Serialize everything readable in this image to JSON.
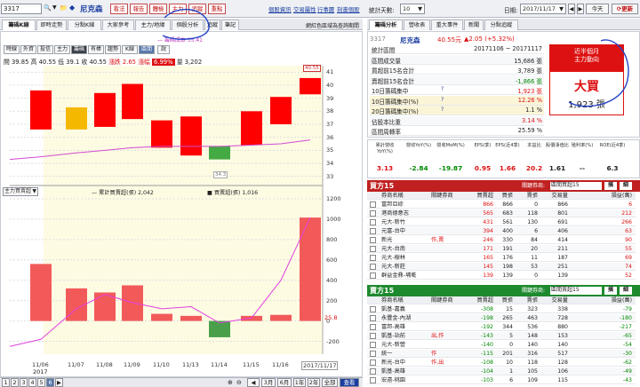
{
  "topbar": {
    "code": "3317",
    "stock_name": "尼克森",
    "buttons": [
      "看法",
      "報告",
      "體檢",
      "主力",
      "追蹤",
      "重點"
    ],
    "links": [
      "個股資訊",
      "交易屬性",
      "行事曆",
      "刻畫個股"
    ],
    "days_label": "統計天數:",
    "days_value": "10",
    "date_label": "日期:",
    "date_value": "2017/11/17",
    "today_btn": "今天",
    "refresh_btn": "更新"
  },
  "left_tabs": [
    "籌碼K線",
    "即時走勢",
    "分點K線",
    "大家參考",
    "主力/地緣",
    "個股分析",
    "追蹤",
    "筆記"
  ],
  "left_tab_note": "網紅色區域為查詢期間",
  "sub_buttons": [
    "時線",
    "外資",
    "投信",
    "主力",
    "籌碼",
    "有棒",
    "趨勢",
    "K線",
    "區間",
    "說"
  ],
  "quote": {
    "open_label": "開",
    "open": "39.85",
    "high_label": "高",
    "high": "40.55",
    "low_label": "低",
    "low": "39.1",
    "close_label": "收",
    "close": "40.55",
    "change_label": "漲跌",
    "change": "2.65",
    "pct_label": "漲幅",
    "pct": "6.99%",
    "vol_label": "量",
    "vol": "3,202"
  },
  "ma_note": "— 籌碼成本 35.41",
  "price_axis": [
    "41",
    "40",
    "39",
    "38",
    "37",
    "36",
    "35",
    "34",
    "33"
  ],
  "price_marks": {
    "high": "40.55",
    "low": "34.3"
  },
  "lower_legend": {
    "select": "主力買賣超",
    "line": "— 累計買賣超(張) 2,042",
    "bar": "■ 買賣超(張) 1,016"
  },
  "vol_axis": [
    "1200",
    "1000",
    "800",
    "600",
    "400",
    "200",
    "0",
    "-200"
  ],
  "vol_mark": "25.8",
  "x_labels": [
    "11/06",
    "11/07",
    "11/08",
    "11/09",
    "11/10",
    "11/13",
    "11/14",
    "11/15",
    "11/16",
    "2017/11/17"
  ],
  "x_year": "2017",
  "bottom": {
    "pages": [
      "1",
      "2",
      "3",
      "4",
      "5",
      "6"
    ],
    "zoom": [
      "3月",
      "6月",
      "1年",
      "2年",
      "全部",
      "查看"
    ]
  },
  "right_tabs": [
    "籌碼分析",
    "營收表",
    "重大事件",
    "新聞",
    "分點追蹤"
  ],
  "summary": {
    "code": "3317",
    "name": "尼克森",
    "price": "40.55元",
    "change": "▲2.05 (+5.32%)",
    "rows": [
      {
        "label": "統計區間",
        "value": "20171106 ~ 20171117"
      },
      {
        "label": "區間成交量",
        "value": "15,686 張"
      },
      {
        "label": "買超前15名合計",
        "value": "3,789 張"
      },
      {
        "label": "賣超前15名合計",
        "value": "-1,866 張"
      },
      {
        "label": "10日籌碼集中",
        "value": "1,923 張"
      },
      {
        "label": "10日籌碼集中(%)",
        "value": "12.26 %"
      },
      {
        "label": "20日籌碼集中(%)",
        "value": "1.1 %"
      },
      {
        "label": "佔股本比重",
        "value": "3.14 %"
      },
      {
        "label": "區間周轉率",
        "value": "25.59 %"
      }
    ],
    "badge_title": "近半個月",
    "badge_sub": "主力動向",
    "badge_main": "大買",
    "badge_value": "1,923 張"
  },
  "stats_head": [
    "累計營收YoY(%)",
    "營收YoY(%)",
    "營收MoM(%)",
    "EPS(季)",
    "EPS(近4季)",
    "本益比",
    "股價淨值比",
    "殖利率(%)",
    "ROE(近4季)"
  ],
  "stats_vals": [
    "3.13",
    "-2.84",
    "-19.87",
    "0.95",
    "1.66",
    "20.2",
    "1.61",
    "--",
    "6.3"
  ],
  "buy15": {
    "title": "買方15",
    "select_label": "關鍵券商:",
    "select_value": "區間買超15",
    "head": [
      "券商名稱",
      "關鍵券商",
      "買賣超",
      "買張",
      "賣張",
      "交易量",
      "損益(萬)"
    ],
    "rows": [
      [
        "富邦亞綜",
        "",
        "866",
        "866",
        "0",
        "866",
        "6"
      ],
      [
        "港商德意志",
        "",
        "565",
        "683",
        "118",
        "801",
        "212"
      ],
      [
        "元大-新竹",
        "",
        "431",
        "561",
        "130",
        "691",
        "266"
      ],
      [
        "元富-台中",
        "",
        "394",
        "400",
        "6",
        "406",
        "63"
      ],
      [
        "新光",
        "作,賣",
        "246",
        "330",
        "84",
        "414",
        "90"
      ],
      [
        "元大-台南",
        "",
        "171",
        "191",
        "20",
        "211",
        "55"
      ],
      [
        "元大-樹林",
        "",
        "165",
        "176",
        "11",
        "187",
        "69"
      ],
      [
        "元大-新莊",
        "",
        "145",
        "198",
        "53",
        "251",
        "74"
      ],
      [
        "群益金鼎-埔墘",
        "",
        "139",
        "139",
        "0",
        "139",
        "52"
      ]
    ]
  },
  "sell15": {
    "title": "賣方15",
    "select_label": "關鍵券商:",
    "select_value": "區間賣超15",
    "head": [
      "券商名稱",
      "關鍵券商",
      "買賣超",
      "買張",
      "賣張",
      "交易量",
      "損益(萬)"
    ],
    "rows": [
      [
        "凱基-嘉義",
        "",
        "-308",
        "15",
        "323",
        "338",
        "-79"
      ],
      [
        "永豐金-內湖",
        "",
        "-198",
        "265",
        "463",
        "728",
        "-180"
      ],
      [
        "富邦-高雄",
        "",
        "-192",
        "344",
        "536",
        "880",
        "-217"
      ],
      [
        "凱基-站前",
        "出,作",
        "-143",
        "5",
        "148",
        "153",
        "-65"
      ],
      [
        "元大-新營",
        "",
        "-140",
        "0",
        "140",
        "140",
        "-54"
      ],
      [
        "統一",
        "作",
        "-115",
        "201",
        "316",
        "517",
        "-30"
      ],
      [
        "新光-台中",
        "作,出",
        "-108",
        "10",
        "118",
        "128",
        "-62"
      ],
      [
        "凱基-高雄",
        "",
        "-104",
        "1",
        "105",
        "106",
        "-49"
      ],
      [
        "宏遠-桃園",
        "",
        "-103",
        "6",
        "109",
        "115",
        "-43"
      ]
    ]
  }
}
